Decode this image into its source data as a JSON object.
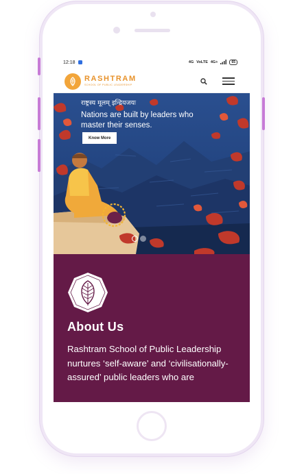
{
  "status_bar": {
    "time": "12:18",
    "indicators": [
      "4G",
      "VoLTE",
      "4G+",
      "LTE"
    ],
    "battery": "65"
  },
  "header": {
    "brand_name": "RASHTRAM",
    "brand_subtitle": "SCHOOL OF PUBLIC LEADERSHIP",
    "icons": [
      "search-icon",
      "hamburger-menu-icon"
    ]
  },
  "hero": {
    "sanskrit_line": "राष्ट्रस्य मूलम् इन्द्रियजयः",
    "tagline": "Nations are built by leaders who master their senses.",
    "button_label": "Know More",
    "slides_count": 2,
    "active_slide": 1
  },
  "about": {
    "title": "About Us",
    "body": "Rashtram School of Public Leadership nurtures ‘self-aware’ and ‘civilisationally-assured’ public leaders who are"
  },
  "colors": {
    "brand_orange": "#e8932c",
    "about_bg": "#641a47",
    "hero_blue": "#1f3f7a",
    "phone_accent": "#c77bd6"
  }
}
